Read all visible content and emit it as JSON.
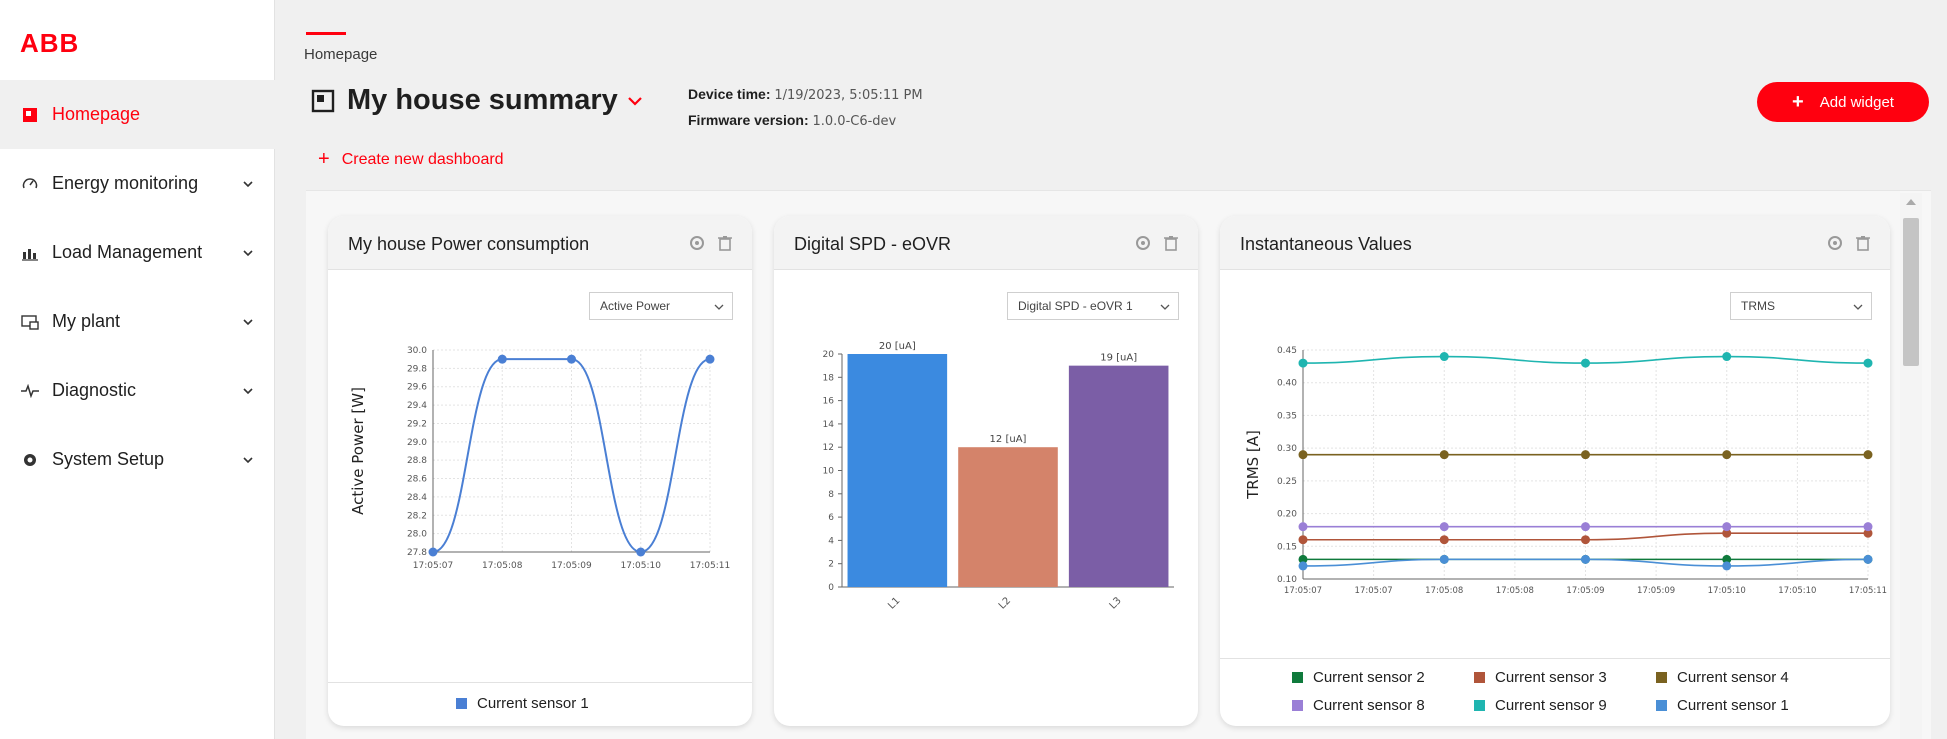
{
  "brand": {
    "logo_text": "ABB",
    "accent": "#ff000f"
  },
  "sidebar": {
    "items": [
      {
        "label": "Homepage",
        "icon": "homepage-icon",
        "active": true
      },
      {
        "label": "Energy monitoring",
        "icon": "gauge-icon",
        "active": false
      },
      {
        "label": "Load Management",
        "icon": "bar-chart-icon",
        "active": false
      },
      {
        "label": "My plant",
        "icon": "plant-icon",
        "active": false
      },
      {
        "label": "Diagnostic",
        "icon": "pulse-icon",
        "active": false
      },
      {
        "label": "System Setup",
        "icon": "gear-icon",
        "active": false
      }
    ]
  },
  "header": {
    "breadcrumb": "Homepage",
    "title": "My house summary",
    "device_time_label": "Device time:",
    "device_time_value": "1/19/2023, 5:05:11 PM",
    "firmware_label": "Firmware version:",
    "firmware_value": "1.0.0-C6-dev",
    "add_widget_label": "Add widget",
    "create_dashboard_label": "Create new dashboard"
  },
  "widgets": {
    "power": {
      "title": "My house Power consumption",
      "select_value": "Active Power",
      "legend": [
        {
          "name": "Current sensor 1",
          "color": "#4a7fd4"
        }
      ]
    },
    "spd": {
      "title": "Digital SPD - eOVR",
      "select_value": "Digital SPD - eOVR 1"
    },
    "inst": {
      "title": "Instantaneous Values",
      "select_value": "TRMS",
      "legend": [
        {
          "name": "Current sensor 2",
          "color": "#0f7a3c"
        },
        {
          "name": "Current sensor 3",
          "color": "#b0553a"
        },
        {
          "name": "Current sensor 4",
          "color": "#7a6220"
        },
        {
          "name": "Current sensor 8",
          "color": "#9a7fd6"
        },
        {
          "name": "Current sensor 9",
          "color": "#1fb5b0"
        },
        {
          "name": "Current sensor 1",
          "color": "#4a8fd6"
        }
      ]
    }
  },
  "chart_data": [
    {
      "type": "line",
      "title": "My house Power consumption",
      "xlabel": "",
      "ylabel": "Active Power [W]",
      "x": [
        "17:05:07",
        "17:05:08",
        "17:05:09",
        "17:05:10",
        "17:05:11"
      ],
      "ylim": [
        27.8,
        30.0
      ],
      "yticks": [
        "27.8",
        "28.0",
        "28.2",
        "28.4",
        "28.6",
        "28.8",
        "29.0",
        "29.2",
        "29.4",
        "29.6",
        "29.8",
        "30.0"
      ],
      "series": [
        {
          "name": "Current sensor 1",
          "color": "#4a7fd4",
          "values": [
            27.8,
            29.9,
            29.9,
            27.8,
            29.9
          ]
        }
      ],
      "grid": true
    },
    {
      "type": "bar",
      "title": "Digital SPD - eOVR",
      "categories": [
        "L1",
        "L2",
        "L3"
      ],
      "values": [
        20,
        12,
        19
      ],
      "labels": [
        "20 [uA]",
        "12 [uA]",
        "19 [uA]"
      ],
      "colors": [
        "#3b8ae0",
        "#d4836a",
        "#7b5ea6"
      ],
      "ylim": [
        0,
        20
      ],
      "yticks": [
        "0",
        "2",
        "4",
        "6",
        "8",
        "10",
        "12",
        "14",
        "16",
        "18",
        "20"
      ]
    },
    {
      "type": "line",
      "title": "Instantaneous Values",
      "xlabel": "",
      "ylabel": "TRMS [A]",
      "x": [
        "17:05:07",
        "17:05:08",
        "17:05:09",
        "17:05:10",
        "17:05:11"
      ],
      "xticks": [
        "17:05:07",
        "17:05:07",
        "17:05:08",
        "17:05:08",
        "17:05:09",
        "17:05:09",
        "17:05:10",
        "17:05:10",
        "17:05:11"
      ],
      "ylim": [
        0.1,
        0.45
      ],
      "yticks": [
        "0.10",
        "0.15",
        "0.20",
        "0.25",
        "0.30",
        "0.35",
        "0.40",
        "0.45"
      ],
      "series": [
        {
          "name": "Current sensor 2",
          "color": "#0f7a3c",
          "values": [
            0.13,
            0.13,
            0.13,
            0.13,
            0.13
          ]
        },
        {
          "name": "Current sensor 3",
          "color": "#b0553a",
          "values": [
            0.16,
            0.16,
            0.16,
            0.17,
            0.17
          ]
        },
        {
          "name": "Current sensor 4",
          "color": "#7a6220",
          "values": [
            0.29,
            0.29,
            0.29,
            0.29,
            0.29
          ]
        },
        {
          "name": "Current sensor 8",
          "color": "#9a7fd6",
          "values": [
            0.18,
            0.18,
            0.18,
            0.18,
            0.18
          ]
        },
        {
          "name": "Current sensor 9",
          "color": "#1fb5b0",
          "values": [
            0.43,
            0.44,
            0.43,
            0.44,
            0.43
          ]
        },
        {
          "name": "Current sensor 1",
          "color": "#4a8fd6",
          "values": [
            0.12,
            0.13,
            0.13,
            0.12,
            0.13
          ]
        }
      ],
      "grid": true
    }
  ]
}
